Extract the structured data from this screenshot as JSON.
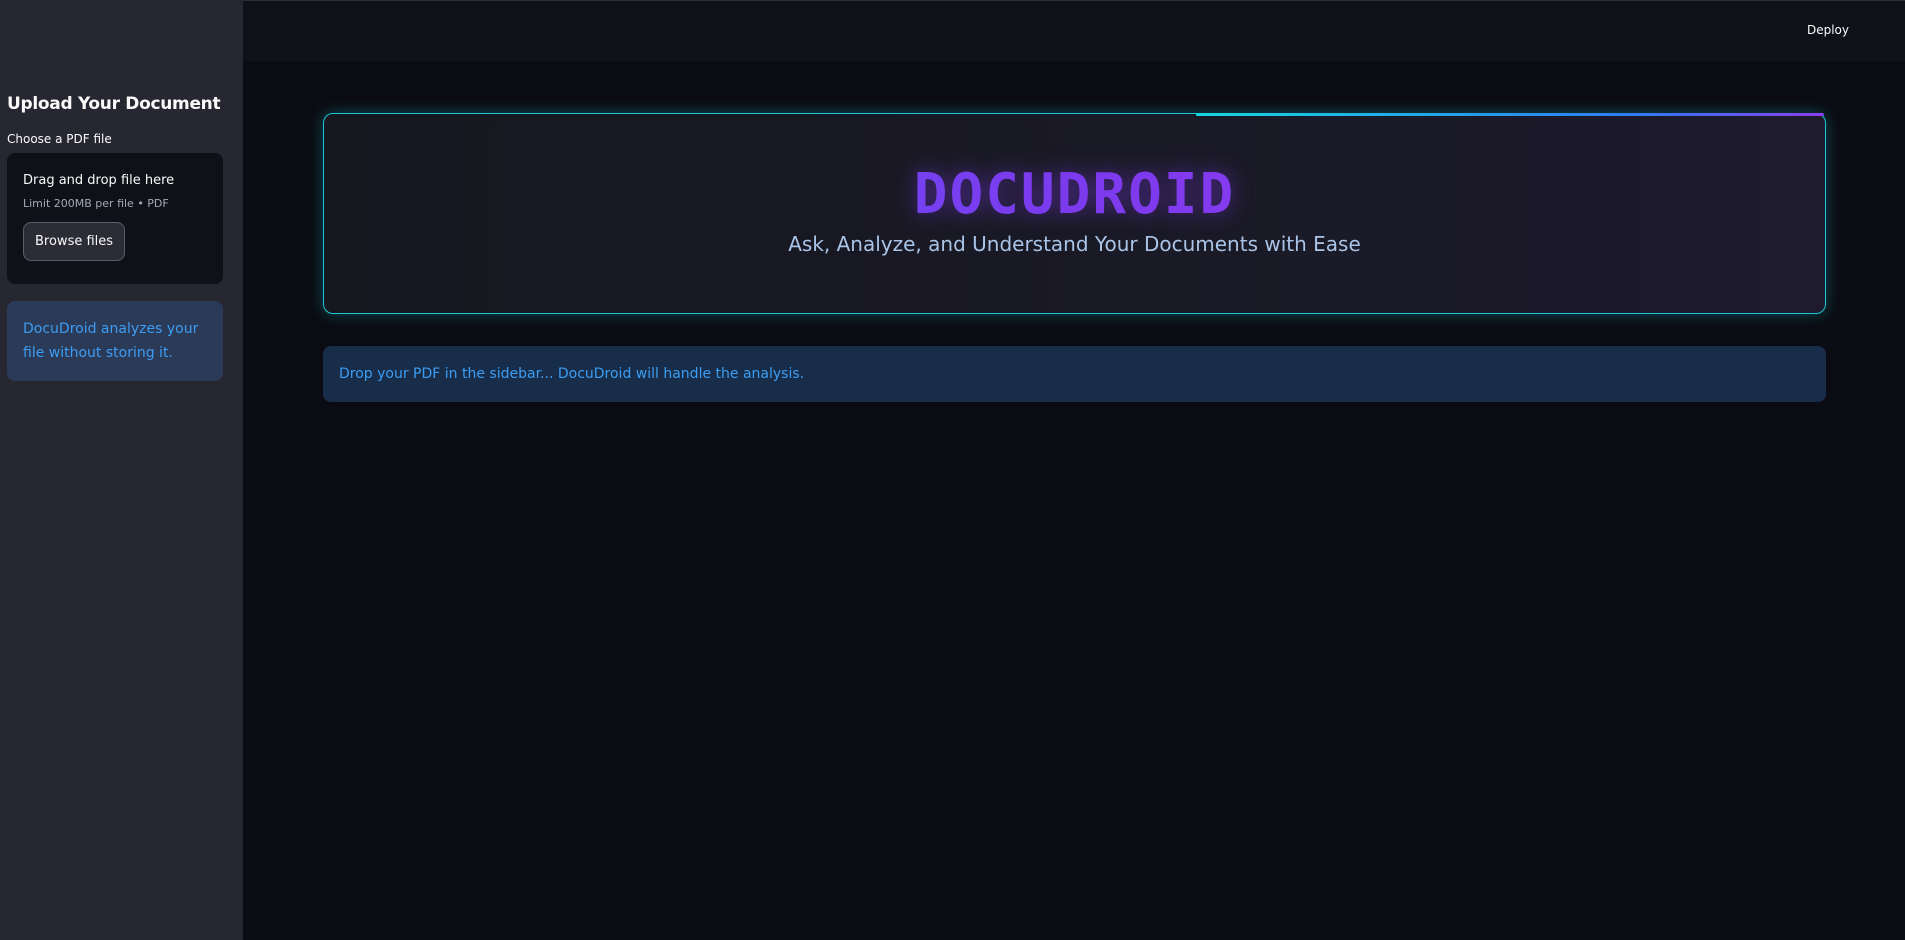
{
  "header": {
    "deploy_label": "Deploy"
  },
  "sidebar": {
    "title": "Upload Your Document",
    "uploader_label": "Choose a PDF file",
    "dropzone": {
      "title": "Drag and drop file here",
      "limit": "Limit 200MB per file • PDF",
      "browse_label": "Browse files"
    },
    "note": "DocuDroid analyzes your file without storing it."
  },
  "main": {
    "brand": "DOCUDROID",
    "tagline": "Ask, Analyze, and Understand Your Documents with Ease",
    "info": "Drop your PDF in the sidebar... DocuDroid will handle the analysis."
  },
  "colors": {
    "accent_cyan": "#19c7d6",
    "brand_purple": "#7c3aed",
    "info_text": "#3d9df3"
  }
}
